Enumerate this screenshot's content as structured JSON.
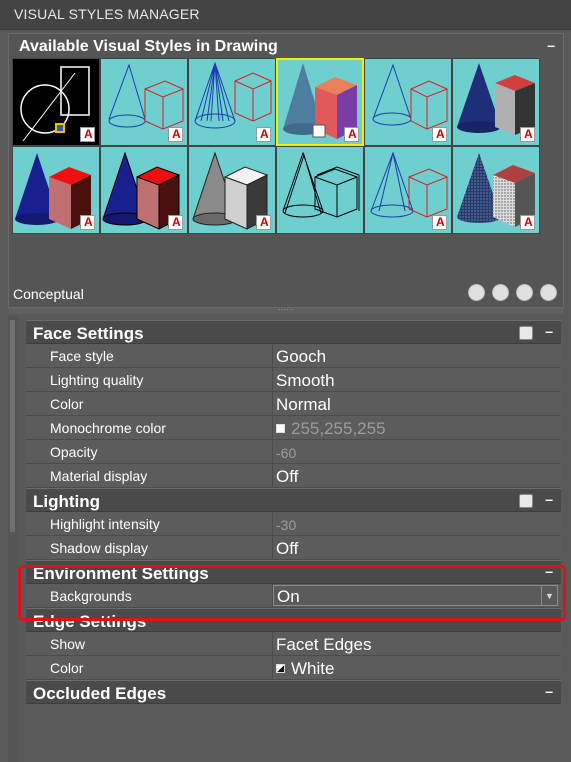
{
  "window": {
    "title": "VISUAL STYLES MANAGER"
  },
  "available_panel": {
    "title": "Available Visual Styles in Drawing",
    "collapse_symbol": "–",
    "current_style": "Conceptual",
    "thumbnails": [
      {
        "style": "2D Wireframe",
        "bg": "#000000"
      },
      {
        "style": "Hidden wireframe",
        "bg": "#6fcfcf"
      },
      {
        "style": "Wireframe",
        "bg": "#6fcfcf"
      },
      {
        "style": "Conceptual",
        "bg": "#6fcfcf",
        "selected": true
      },
      {
        "style": "Hidden",
        "bg": "#6fcfcf"
      },
      {
        "style": "Textured",
        "bg": "#6fcfcf"
      },
      {
        "style": "Shaded",
        "bg": "#6fcfcf"
      },
      {
        "style": "Shaded with edges",
        "bg": "#6fcfcf"
      },
      {
        "style": "Shades of Gray",
        "bg": "#6fcfcf"
      },
      {
        "style": "Sketchy",
        "bg": "#6fcfcf"
      },
      {
        "style": "X-Ray wire",
        "bg": "#6fcfcf"
      },
      {
        "style": "Stippled",
        "bg": "#6fcfcf"
      }
    ],
    "tools": [
      "create-style-icon",
      "apply-to-viewport-icon",
      "export-to-palette-icon",
      "delete-style-icon"
    ]
  },
  "sections": {
    "face": {
      "title": "Face Settings",
      "collapse_symbol": "–",
      "rows": [
        {
          "label": "Face style",
          "value": "Gooch"
        },
        {
          "label": "Lighting quality",
          "value": "Smooth"
        },
        {
          "label": "Color",
          "value": "Normal"
        },
        {
          "label": "Monochrome color",
          "value": "255,255,255"
        },
        {
          "label": "Opacity",
          "value": "-60"
        },
        {
          "label": "Material display",
          "value": "Off"
        }
      ]
    },
    "lighting": {
      "title": "Lighting",
      "collapse_symbol": "–",
      "rows": [
        {
          "label": "Highlight intensity",
          "value": "-30"
        },
        {
          "label": "Shadow display",
          "value": "Off"
        }
      ]
    },
    "environment": {
      "title": "Environment Settings",
      "collapse_symbol": "–",
      "rows": [
        {
          "label": "Backgrounds",
          "value": "On"
        }
      ]
    },
    "edge": {
      "title": "Edge Settings",
      "collapse_symbol": "–",
      "rows": [
        {
          "label": "Show",
          "value": "Facet Edges"
        },
        {
          "label": "Color",
          "value": "White"
        }
      ]
    },
    "occluded": {
      "title": "Occluded Edges",
      "collapse_symbol": "–"
    }
  },
  "colors": {
    "highlight_box": "#e0111c",
    "thumb_bg": "#6fcfcf",
    "selected_border": "#f2f200",
    "panel_bg": "#595959"
  }
}
